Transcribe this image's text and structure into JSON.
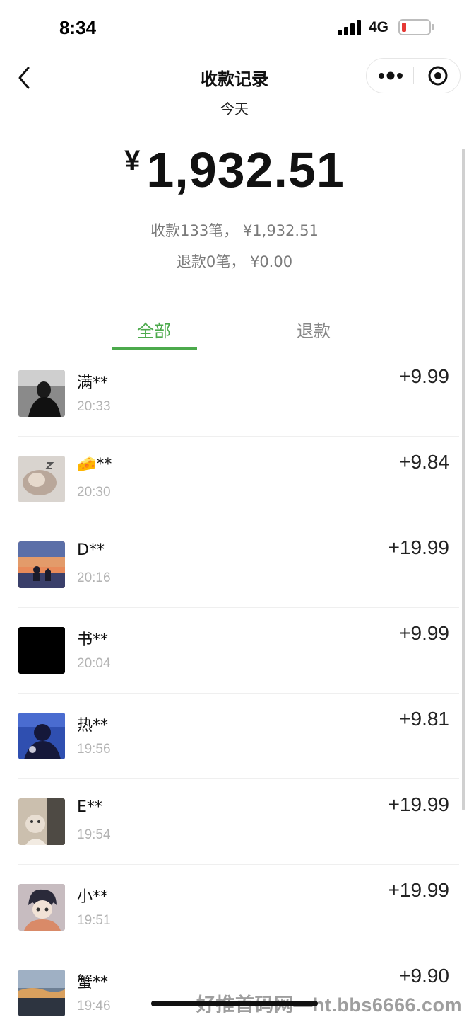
{
  "status_bar": {
    "time": "8:34",
    "network": "4G"
  },
  "nav": {
    "title": "收款记录",
    "back_icon": "chevron-left-icon",
    "more_icon": "more-dots-icon",
    "close_icon": "target-close-icon"
  },
  "header": {
    "date": "今天",
    "total_currency": "¥",
    "total_amount": "1,932.51",
    "receipts_summary": "收款133笔， ¥1,932.51",
    "refunds_summary": "退款0笔， ¥0.00"
  },
  "tabs": [
    {
      "label": "全部",
      "active": true
    },
    {
      "label": "退款",
      "active": false
    }
  ],
  "transactions": [
    {
      "name": "满**",
      "time": "20:33",
      "amount": "+9.99",
      "avatar": "avatar-dark-photo"
    },
    {
      "name": "🧀**",
      "time": "20:30",
      "amount": "+9.84",
      "avatar": "avatar-sleeping-cat"
    },
    {
      "name": "D**",
      "time": "20:16",
      "amount": "+19.99",
      "avatar": "avatar-sunset-silhouette"
    },
    {
      "name": "书**",
      "time": "20:04",
      "amount": "+9.99",
      "avatar": "avatar-black-square"
    },
    {
      "name": "热**",
      "time": "19:56",
      "amount": "+9.81",
      "avatar": "avatar-blue-anime"
    },
    {
      "name": "E**",
      "time": "19:54",
      "amount": "+19.99",
      "avatar": "avatar-cat-photo"
    },
    {
      "name": "小**",
      "time": "19:51",
      "amount": "+19.99",
      "avatar": "avatar-anime-boy"
    },
    {
      "name": "蟹**",
      "time": "19:46",
      "amount": "+9.90",
      "avatar": "avatar-sky-photo"
    }
  ],
  "watermark": "好推首码网—ht.bbs6666.com",
  "colors": {
    "accent": "#4caa4c",
    "battery_low": "#e53935",
    "muted_text": "#7a7a7a"
  }
}
